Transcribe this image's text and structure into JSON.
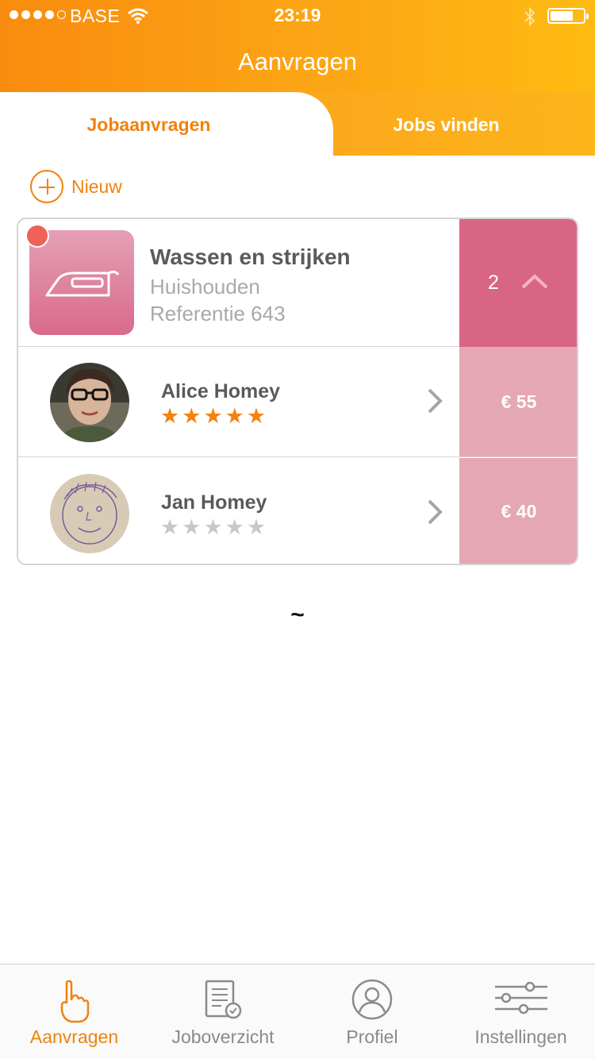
{
  "status_bar": {
    "carrier": "BASE",
    "time": "23:19",
    "icons": [
      "signal-icon",
      "wifi-icon",
      "bluetooth-icon",
      "battery-icon"
    ]
  },
  "header": {
    "title": "Aanvragen"
  },
  "tabs": [
    {
      "label": "Jobaanvragen",
      "active": true
    },
    {
      "label": "Jobs vinden",
      "active": false
    }
  ],
  "new_button": {
    "label": "Nieuw",
    "icon": "plus-circle-icon"
  },
  "job": {
    "title": "Wassen en strijken",
    "category": "Huishouden",
    "reference": "Referentie 643",
    "count": "2",
    "icon": "iron-icon",
    "has_notification": true
  },
  "bids": [
    {
      "name": "Alice Homey",
      "rating": 5,
      "price": "€ 55"
    },
    {
      "name": "Jan Homey",
      "rating": 0,
      "price": "€ 40"
    }
  ],
  "separator_glyph": "~",
  "tabbar": [
    {
      "label": "Aanvragen",
      "icon": "hand-pointer-icon",
      "active": true
    },
    {
      "label": "Joboverzicht",
      "icon": "document-check-icon",
      "active": false
    },
    {
      "label": "Profiel",
      "icon": "user-circle-icon",
      "active": false
    },
    {
      "label": "Instellingen",
      "icon": "sliders-icon",
      "active": false
    }
  ],
  "colors": {
    "accent": "#f0820f",
    "header_gradient_start": "#f98c0e",
    "header_gradient_end": "#fdbb12",
    "job_pink": "#d96585",
    "price_pink": "#e5a7b4",
    "notification": "#f0615a"
  }
}
